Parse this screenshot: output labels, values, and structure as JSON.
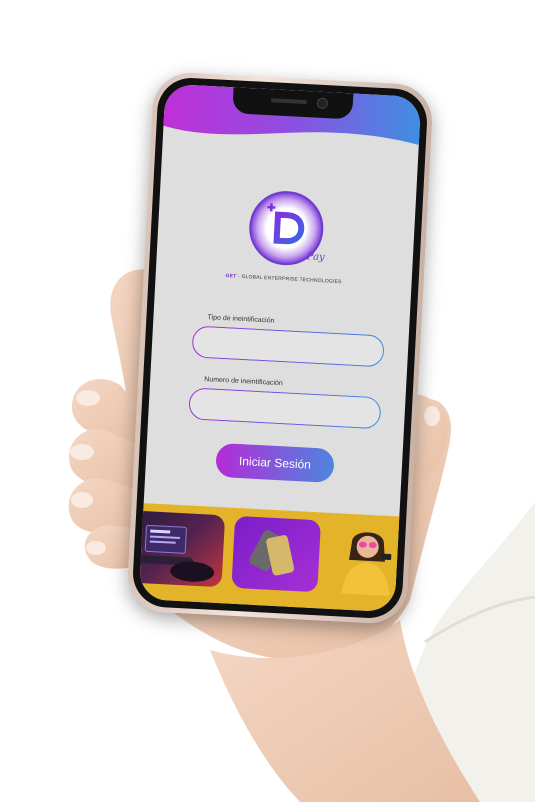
{
  "app": {
    "logo_letter": "D",
    "logo_script": "Pay",
    "tagline_brand": "GET",
    "tagline_text": "· GLOBAL ENTERPRISE TECHNOLOGIES"
  },
  "form": {
    "id_type_label": "Tipo de ineintificación",
    "id_type_value": "",
    "id_number_label": "Numero de ineintificación",
    "id_number_value": ""
  },
  "actions": {
    "login_label": "Iniciar Sesión"
  },
  "colors": {
    "accent_purple": "#b52bd6",
    "accent_blue": "#4d86de",
    "promo_yellow": "#e3b42a",
    "screen_bg": "#dedede"
  }
}
